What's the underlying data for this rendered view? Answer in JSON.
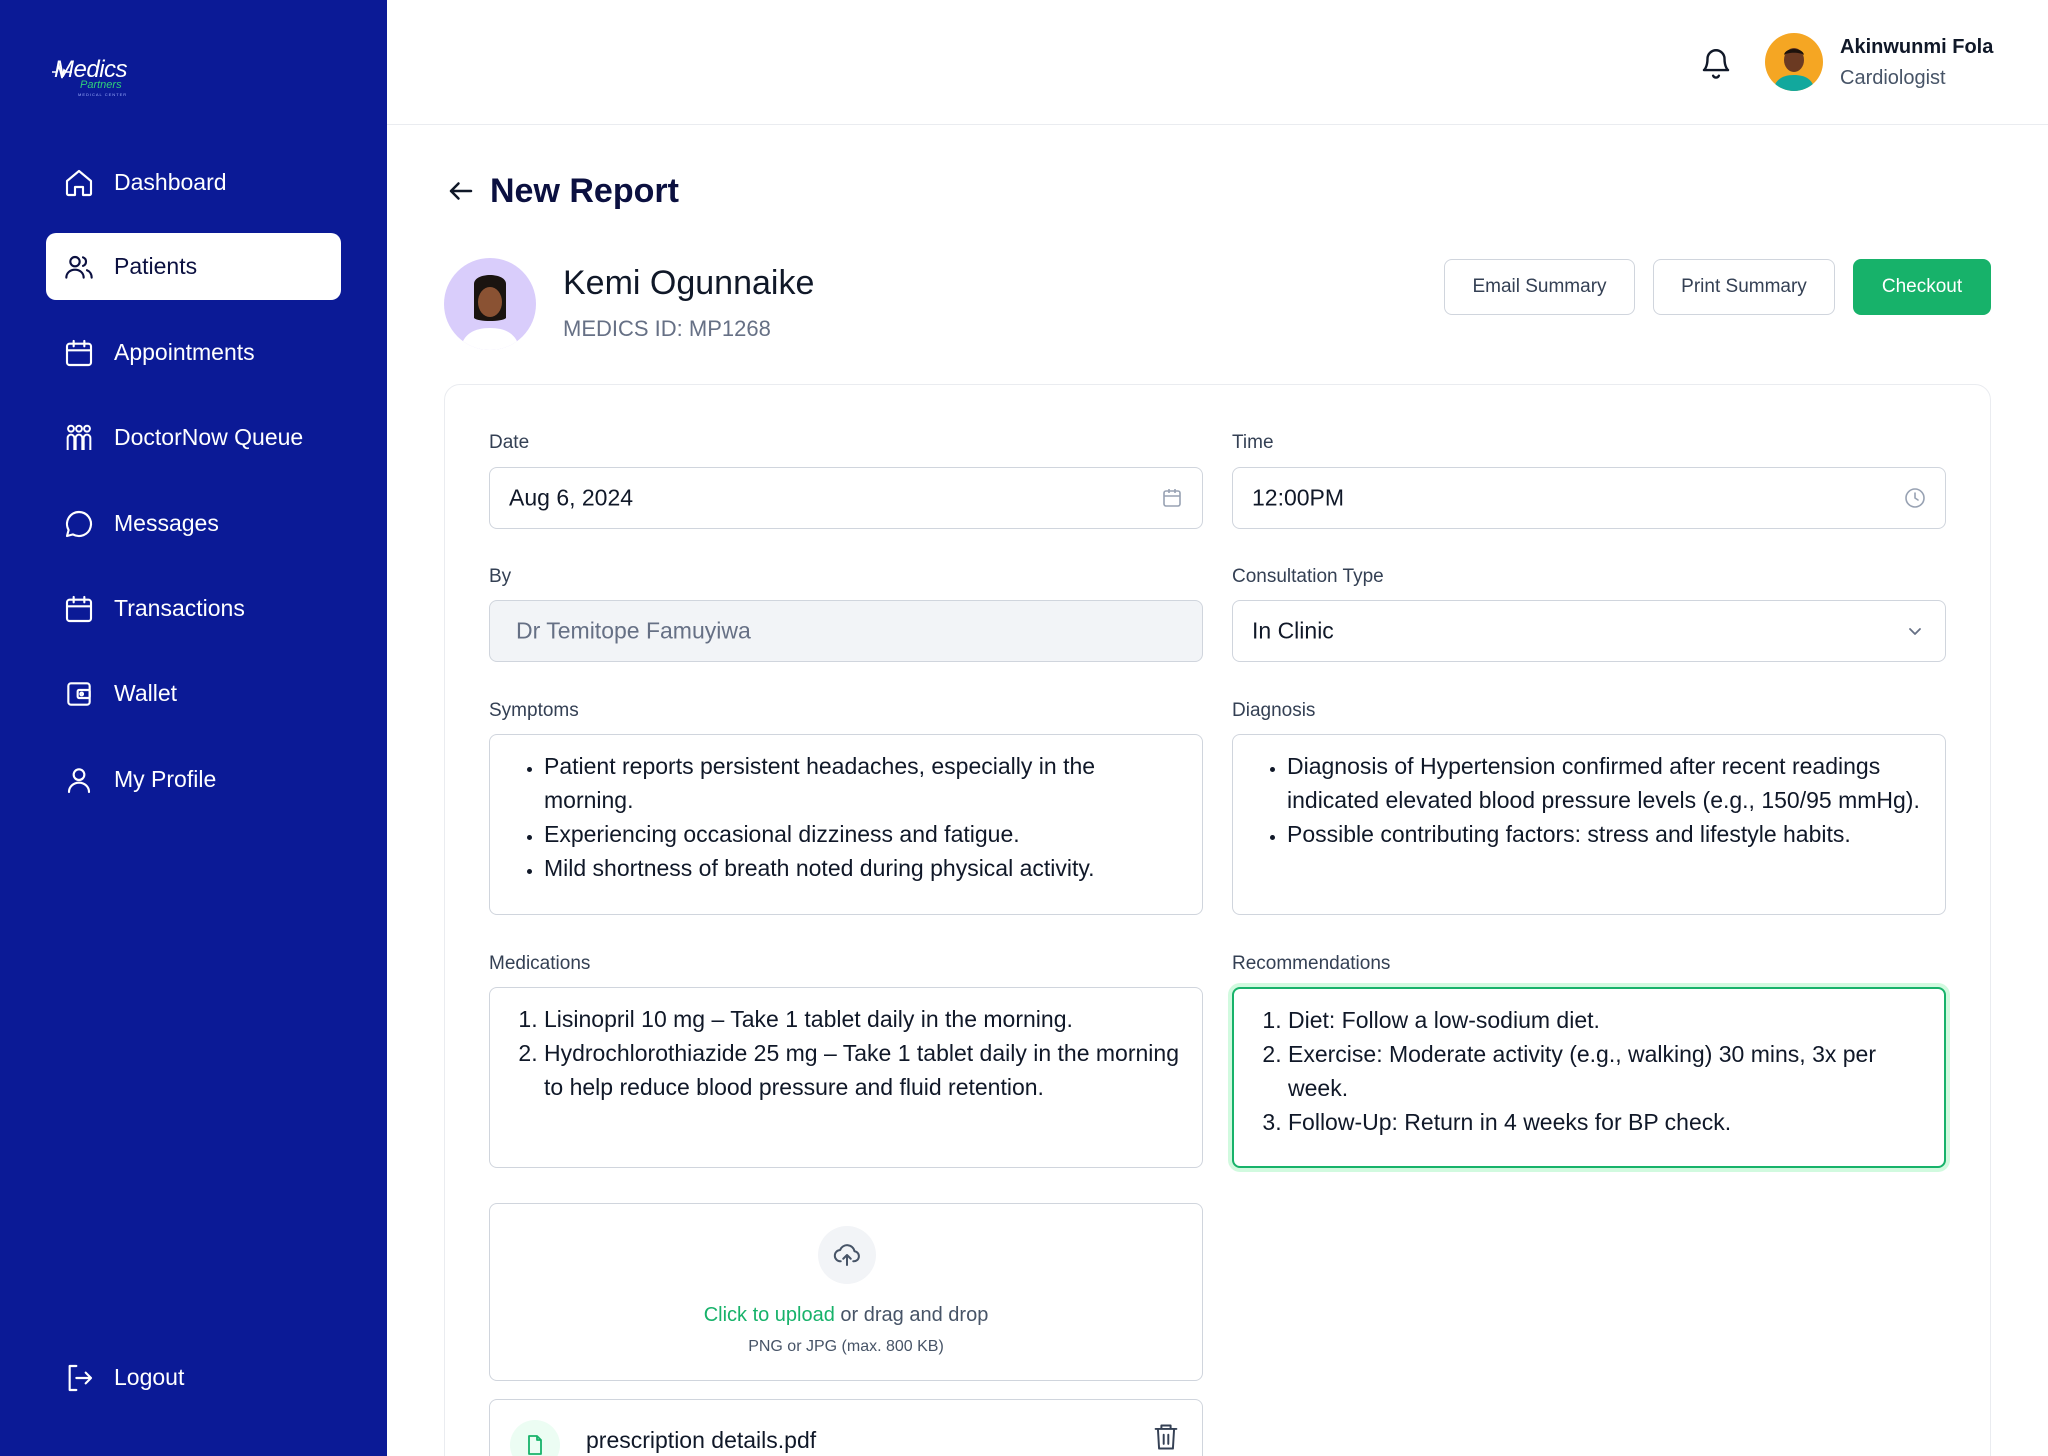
{
  "brand": {
    "name": "Medics",
    "sub": "Partners",
    "tagline": "MEDICAL CENTER"
  },
  "sidebar": {
    "items": [
      {
        "label": "Dashboard",
        "icon": "home-icon"
      },
      {
        "label": "Patients",
        "icon": "users-icon",
        "active": true
      },
      {
        "label": "Appointments",
        "icon": "calendar-icon"
      },
      {
        "label": "DoctorNow Queue",
        "icon": "queue-icon"
      },
      {
        "label": "Messages",
        "icon": "chat-icon"
      },
      {
        "label": "Transactions",
        "icon": "calendar-icon"
      },
      {
        "label": "Wallet",
        "icon": "wallet-icon"
      },
      {
        "label": "My Profile",
        "icon": "user-icon"
      }
    ],
    "logout": "Logout"
  },
  "user": {
    "name": "Akinwunmi Fola",
    "role": "Cardiologist"
  },
  "page": {
    "title": "New Report"
  },
  "patient": {
    "name": "Kemi Ogunnaike",
    "id": "MEDICS ID: MP1268"
  },
  "actions": {
    "email": "Email Summary",
    "print": "Print Summary",
    "checkout": "Checkout"
  },
  "form": {
    "date": {
      "label": "Date",
      "value": "Aug 6, 2024"
    },
    "time": {
      "label": "Time",
      "value": "12:00PM"
    },
    "by": {
      "label": "By",
      "value": "Dr Temitope Famuyiwa"
    },
    "consultation": {
      "label": "Consultation Type",
      "value": "In Clinic"
    },
    "symptoms": {
      "label": "Symptoms",
      "items": [
        "Patient reports persistent headaches, especially in the morning.",
        "Experiencing occasional dizziness and fatigue.",
        "Mild shortness of breath noted during physical activity."
      ]
    },
    "diagnosis": {
      "label": "Diagnosis",
      "items": [
        "Diagnosis of Hypertension confirmed after recent readings indicated elevated blood pressure levels (e.g., 150/95 mmHg).",
        "Possible contributing factors: stress and lifestyle habits."
      ]
    },
    "medications": {
      "label": "Medications",
      "items": [
        "Lisinopril 10 mg – Take 1 tablet daily in the morning.",
        "Hydrochlorothiazide 25 mg – Take 1 tablet daily in the morning to help reduce blood pressure and fluid retention."
      ]
    },
    "recommendations": {
      "label": "Recommendations",
      "items": [
        "Diet: Follow a low-sodium diet.",
        "Exercise: Moderate activity (e.g., walking) 30 mins, 3x per week.",
        "Follow-Up: Return in 4 weeks for BP check."
      ]
    }
  },
  "upload": {
    "link": "Click to upload",
    "rest": " or drag and drop",
    "hint": "PNG or JPG (max. 800 KB)"
  },
  "attachment": {
    "name": "prescription details.pdf"
  },
  "colors": {
    "sidebar": "#0b1a96",
    "accent": "#17b26a",
    "title": "#0b1040"
  }
}
